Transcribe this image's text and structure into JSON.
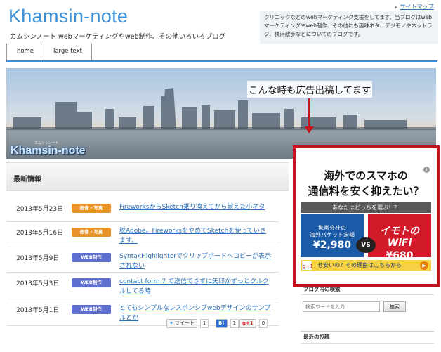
{
  "header": {
    "title": "Khamsin-note",
    "description": "カムシンノート webマーケティングやweb制作、その他いろいろブログ",
    "sitemap_link": "サイトマップ",
    "notice": "クリニックなどのwebマーケティング支援をしてます。当ブログはwebマーケティングやweb制作、その他にも趣味ネタ、デジモノやネットラジ、横浜散歩などについてのブログです。"
  },
  "nav": {
    "items": [
      {
        "label": "home"
      },
      {
        "label": "large text"
      }
    ]
  },
  "hero": {
    "logo": "Khamsin-note",
    "logo_small": "カムシンノート"
  },
  "overlay": {
    "text": "こんな時も広告出稿してます"
  },
  "news": {
    "heading": "最新情報",
    "items": [
      {
        "date": "2013年5月23日",
        "category": "画像・写真",
        "title": "FireworksからSketch乗り換えてから覚えた小ネタ"
      },
      {
        "date": "2013年5月16日",
        "category": "画像・写真",
        "title": "脱Adobe。Fireworksをやめて​Sketchを使っていきます。"
      },
      {
        "date": "2013年5月9日",
        "category": "WEB制作",
        "title": "SyntaxHighlighterでクリップボードへコピーが表示されない"
      },
      {
        "date": "2013年5月3日",
        "category": "WEB制作",
        "title": "contact form 7 で送信できずに矢印がずっとクルクルしてる時"
      },
      {
        "date": "2013年5月1日",
        "category": "WEB制作",
        "title": "とてもシンプルなレスポンシブwebデザインのサンプルとか"
      }
    ],
    "colors": {
      "photo": "#e8932a",
      "web": "#5f6fd0"
    }
  },
  "share": {
    "tweet_label": "ツイート",
    "tweet_count": "1",
    "hatena_label": "B!",
    "hatena_count": "1",
    "gplus_label": "g+1",
    "gplus_count": "0"
  },
  "ad": {
    "headline_1": "海外でのスマホの",
    "headline_2": "通信料を安く抑えたい？",
    "question": "あなたはどっちを選ぶ！？",
    "left_line1": "携帯会社の",
    "left_line2": "海外パケット定額",
    "left_price": "¥2,980",
    "vs": "VS",
    "right_brand": "イモトのWiFi",
    "right_price": "¥680",
    "bottom_text": "せ安いの？その理由はこちらから",
    "gplus": "g+1",
    "info": "i"
  },
  "sidebar": {
    "search_heading": "ブログ内の検索",
    "search_placeholder": "検索ワードを入力",
    "search_button": "検索",
    "recent_heading": "最近の投稿"
  }
}
